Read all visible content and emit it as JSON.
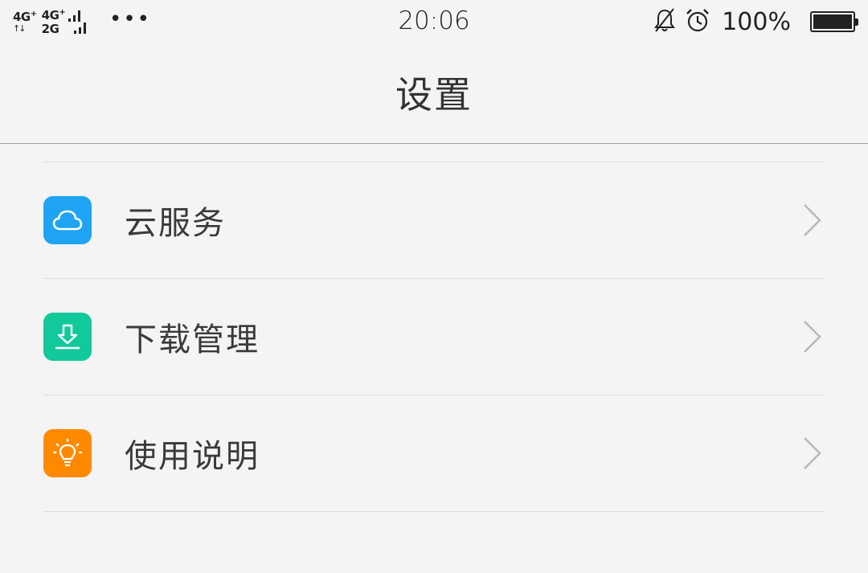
{
  "status_bar": {
    "net1_label": "4G",
    "net1_plus": "+",
    "net2_label": "4G",
    "net2_plus": "+",
    "net2_sub": "2G",
    "data_arrows": "↑↓",
    "more": "•••",
    "time": "20:06",
    "battery": "100%",
    "icons": [
      "signal-icon",
      "more-icon",
      "bell-off-icon",
      "alarm-icon",
      "battery-icon"
    ]
  },
  "header": {
    "title": "设置"
  },
  "menu": {
    "items": [
      {
        "label": "云服务",
        "icon": "cloud-icon",
        "color": "#1ea4f3"
      },
      {
        "label": "下载管理",
        "icon": "download-icon",
        "color": "#12c99c"
      },
      {
        "label": "使用说明",
        "icon": "lightbulb-icon",
        "color": "#ff8a00"
      }
    ]
  },
  "colors": {
    "background": "#f4f4f4",
    "cloud_icon_bg": "#1ea4f3",
    "download_icon_bg": "#12c99c",
    "help_icon_bg": "#ff8a00",
    "chevron": "#b8b8b8"
  }
}
